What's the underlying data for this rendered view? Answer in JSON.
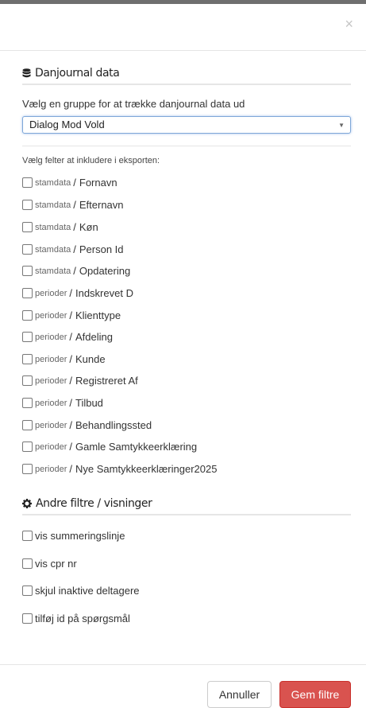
{
  "modal": {
    "close_label": "×"
  },
  "danjournal": {
    "title": "Danjournal data",
    "icon": "database-icon",
    "group_prompt": "Vælg en gruppe for at trække danjournal data ud",
    "selected_group": "Dialog Mod Vold",
    "fields_prompt": "Vælg felter at inkludere i eksporten:",
    "fields": [
      {
        "group": "stamdata",
        "name": "Fornavn",
        "checked": false
      },
      {
        "group": "stamdata",
        "name": "Efternavn",
        "checked": false
      },
      {
        "group": "stamdata",
        "name": "Køn",
        "checked": false
      },
      {
        "group": "stamdata",
        "name": "Person Id",
        "checked": false
      },
      {
        "group": "stamdata",
        "name": "Opdatering",
        "checked": false
      },
      {
        "group": "perioder",
        "name": "Indskrevet D",
        "checked": false
      },
      {
        "group": "perioder",
        "name": "Klienttype",
        "checked": false
      },
      {
        "group": "perioder",
        "name": "Afdeling",
        "checked": false
      },
      {
        "group": "perioder",
        "name": "Kunde",
        "checked": false
      },
      {
        "group": "perioder",
        "name": "Registreret Af",
        "checked": false
      },
      {
        "group": "perioder",
        "name": "Tilbud",
        "checked": false
      },
      {
        "group": "perioder",
        "name": "Behandlingssted",
        "checked": false
      },
      {
        "group": "perioder",
        "name": "Gamle Samtykkeerklæring",
        "checked": false
      },
      {
        "group": "perioder",
        "name": "Nye Samtykkeerklæringer2025",
        "checked": false
      }
    ],
    "separator": "/"
  },
  "other_filters": {
    "title": "Andre filtre / visninger",
    "icon": "gear-icon",
    "options": [
      {
        "label": "vis summeringslinje",
        "checked": false
      },
      {
        "label": "vis cpr nr",
        "checked": false
      },
      {
        "label": "skjul inaktive deltagere",
        "checked": false
      },
      {
        "label": "tilføj id på spørgsmål",
        "checked": false
      }
    ]
  },
  "footer": {
    "cancel_label": "Annuller",
    "save_label": "Gem filtre"
  },
  "colors": {
    "save_button": "#d9534f",
    "select_focus": "#7ea7d8"
  }
}
